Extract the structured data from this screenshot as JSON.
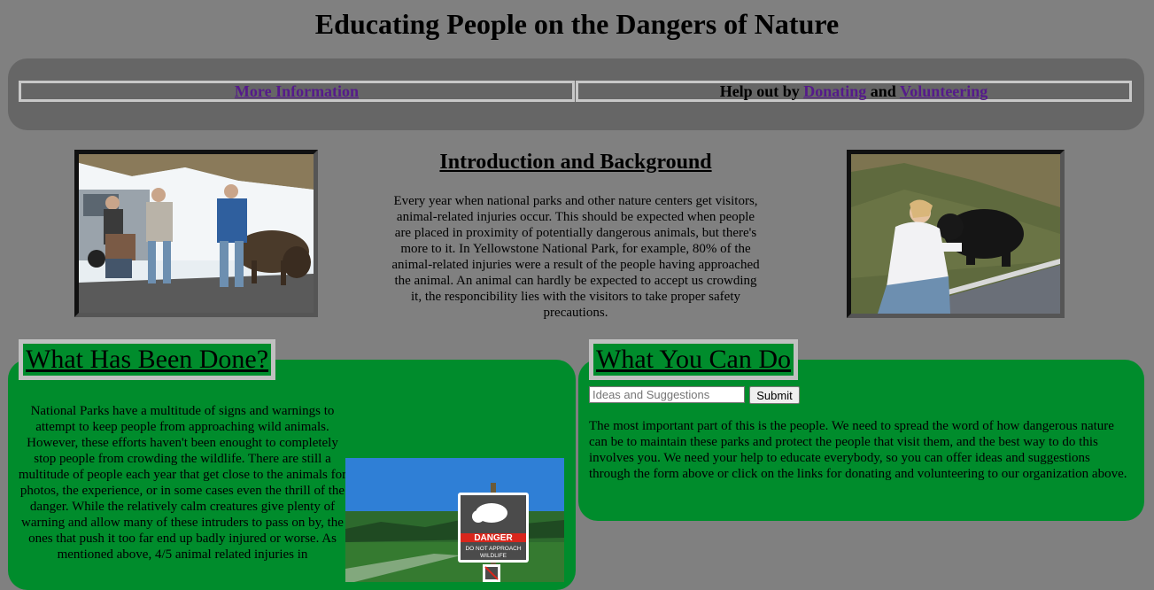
{
  "page_title": "Educating People on the Dangers of Nature",
  "nav": {
    "more_info": "More Information",
    "help_prefix": "Help out by",
    "donating": "Donating",
    "and": "and",
    "volunteering": "Volunteering"
  },
  "intro": {
    "title": "Introduction and Background",
    "text": "Every year when national parks and other nature centers get visitors, animal-related injuries occur. This should be expected when people are placed in proximity of potentially dangerous animals, but there's more to it. In Yellowstone National Park, for example, 80% of the animal-related injuries were a result of the people having approached the animal. An animal can hardly be expected to accept us crowding it, the responcibility lies with the visitors to take proper safety precautions."
  },
  "done": {
    "title": "What Has Been Done?",
    "text": "National Parks have a multitude of signs and warnings to attempt to keep people from approaching wild animals. However, these efforts haven't been enought to completely stop people from crowding the wildlife. There are still a multitude of people each year that get close to the animals for photos, the experience, or in some cases even the thrill of the danger. While the relatively calm creatures give plenty of warning and allow many of these intruders to pass on by, the ones that push it too far end up badly injured or worse. As mentioned above, 4/5 animal related injuries in"
  },
  "sign": {
    "danger": "DANGER",
    "line1": "DO NOT APPROACH",
    "line2": "WILDLIFE"
  },
  "cando": {
    "title": "What You Can Do",
    "placeholder": "Ideas and Suggestions",
    "submit": "Submit",
    "text": "The most important part of this is the people. We need to spread the word of how dangerous nature can be to maintain these parks and protect the people that visit them, and the best way to do this involves you. We need your help to educate everybody, so you can offer ideas and suggestions through the form above or click on the links for donating and volunteering to our organization above."
  }
}
